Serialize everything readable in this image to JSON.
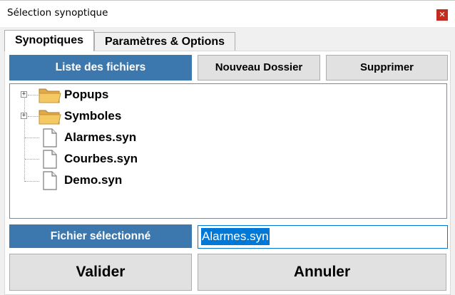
{
  "window": {
    "title": "Sélection synoptique",
    "close_glyph": "✕"
  },
  "tabs": [
    {
      "label": "Synoptiques",
      "active": true
    },
    {
      "label": "Paramètres & Options",
      "active": false
    }
  ],
  "file_list": {
    "header": "Liste des fichiers",
    "new_folder_label": "Nouveau Dossier",
    "delete_label": "Supprimer",
    "items": [
      {
        "label": "Popups",
        "type": "folder",
        "icon": "folder-icon",
        "expander": "+"
      },
      {
        "label": "Symboles",
        "type": "folder",
        "icon": "folder-icon",
        "expander": "+"
      },
      {
        "label": "Alarmes.syn",
        "type": "file",
        "icon": "file-icon"
      },
      {
        "label": "Courbes.syn",
        "type": "file",
        "icon": "file-icon"
      },
      {
        "label": "Demo.syn",
        "type": "file",
        "icon": "file-icon"
      }
    ]
  },
  "selected_file": {
    "label": "Fichier sélectionné",
    "value": "Alarmes.syn"
  },
  "actions": {
    "ok_label": "Valider",
    "cancel_label": "Annuler"
  },
  "colors": {
    "accent": "#3c78ad",
    "selection": "#0078d7",
    "close": "#c42b1c",
    "folder": "#f4c862"
  }
}
